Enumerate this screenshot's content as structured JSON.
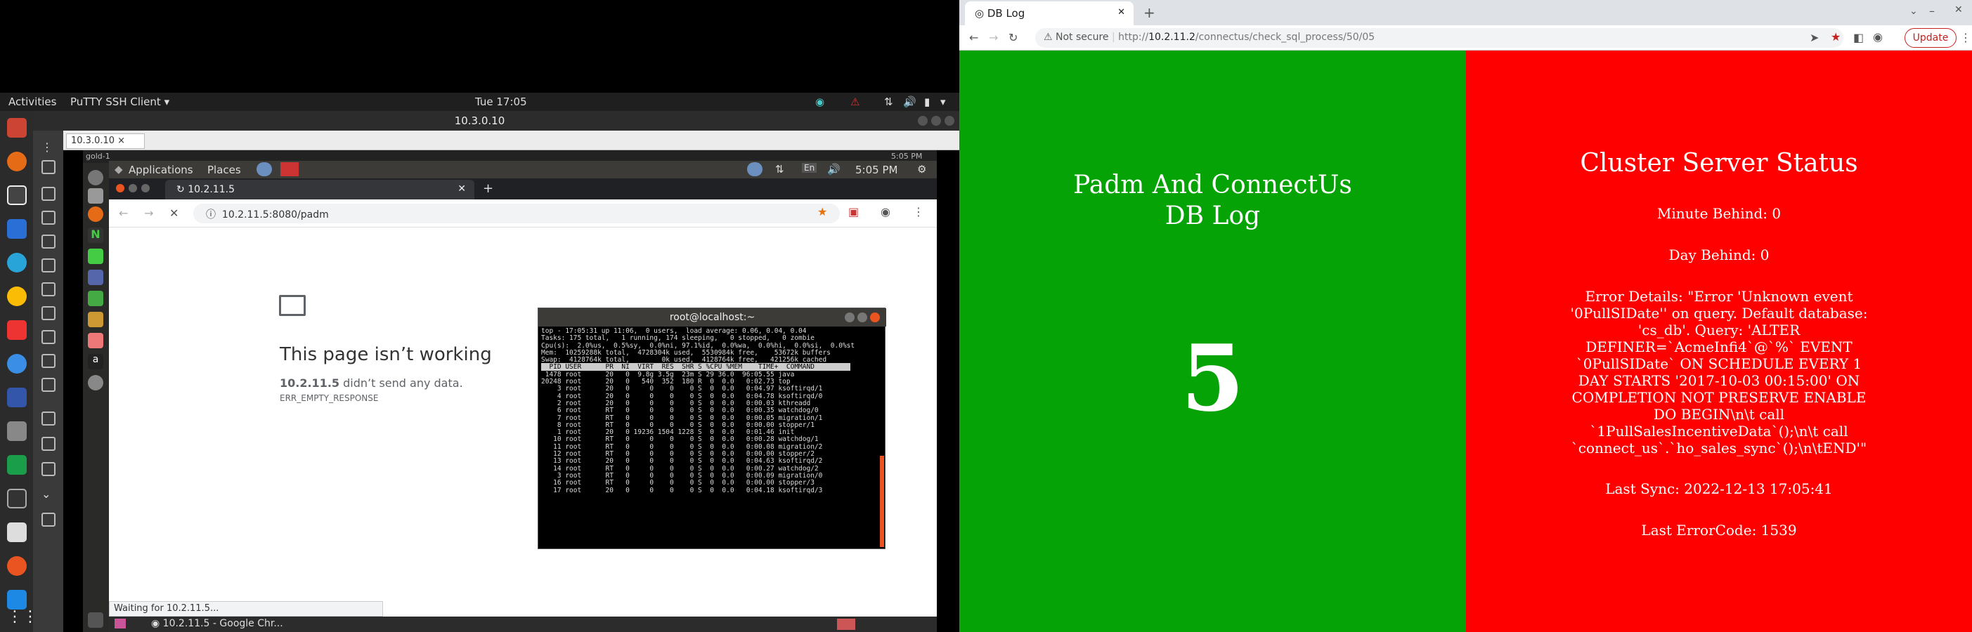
{
  "ubuntu": {
    "activities": "Activities",
    "app": "PuTTY SSH Client ▾",
    "clock": "Tue 17:05",
    "window_title": "10.3.0.10"
  },
  "putty": {
    "tab": "10.3.0.10  ×",
    "host": "gold-1"
  },
  "remote": {
    "topbar_time": "5:05 PM",
    "applications": "Applications",
    "places": "Places",
    "lang": "En",
    "clock": "5:05 PM"
  },
  "inner_chrome": {
    "tab": "10.2.11.5",
    "url": "10.2.11.5:8080/padm",
    "error_title": "This page isn’t working",
    "error_host": "10.2.11.5",
    "error_sub": " didn’t send any data.",
    "error_code": "ERR_EMPTY_RESPONSE",
    "status": "Waiting for 10.2.11.5...",
    "taskbar_item": "10.2.11.5 - Google Chr..."
  },
  "terminal": {
    "title": "root@localhost:~",
    "summary": "top - 17:05:31 up 11:06,  0 users,  load average: 0.06, 0.04, 0.04\nTasks: 175 total,   1 running, 174 sleeping,   0 stopped,   0 zombie\nCpu(s):  2.0%us,  0.5%sy,  0.0%ni, 97.1%id,  0.0%wa,  0.0%hi,  0.0%si,  0.0%st\nMem:  10259288k total,  4728304k used,  5530984k free,    53672k buffers\nSwap:  4128764k total,        0k used,  4128764k free,   421256k cached\n",
    "header": "  PID USER      PR  NI  VIRT  RES  SHR S %CPU %MEM    TIME+  COMMAND         ",
    "rows": " 1478 root      20   0  9.8g 3.5g  23m S 29 36.0  96:05.55 java\n20248 root      20   0   540  352  180 R  0  0.0   0:02.73 top\n    3 root      20   0     0    0    0 S  0  0.0   0:04.97 ksoftirqd/1\n    4 root      20   0     0    0    0 S  0  0.0   0:04.78 ksoftirqd/0\n    2 root      20   0     0    0    0 S  0  0.0   0:00.03 kthreadd\n    6 root      RT   0     0    0    0 S  0  0.0   0:00.35 watchdog/0\n    7 root      RT   0     0    0    0 S  0  0.0   0:00.05 migration/1\n    8 root      RT   0     0    0    0 S  0  0.0   0:00.00 stopper/1\n    1 root      20   0 19236 1504 1228 S  0  0.0   0:01.46 init\n   10 root      RT   0     0    0    0 S  0  0.0   0:00.28 watchdog/1\n   11 root      RT   0     0    0    0 S  0  0.0   0:00.08 migration/2\n   12 root      RT   0     0    0    0 S  0  0.0   0:00.00 stopper/2\n   13 root      20   0     0    0    0 S  0  0.0   0:04.63 ksoftirqd/2\n   14 root      RT   0     0    0    0 S  0  0.0   0:00.27 watchdog/2\n    3 root      RT   0     0    0    0 S  0  0.0   0:00.09 migration/0\n   16 root      RT   0     0    0    0 S  0  0.0   0:00.00 stopper/3\n   17 root      20   0     0    0    0 S  0  0.0   0:04.18 ksoftirqd/3"
  },
  "browser": {
    "tab": "DB Log",
    "not_secure": "Not secure",
    "url_prefix": "http://",
    "url_host": "10.2.11.2",
    "url_path": "/connectus/check_sql_process/50/05",
    "update": "Update"
  },
  "dblog": {
    "title_line1": "Padm And ConnectUs",
    "title_line2": "DB Log",
    "count": "5",
    "status_title": "Cluster Server Status",
    "minute_behind": "Minute Behind: 0",
    "day_behind": "Day Behind: 0",
    "error_details": "Error Details: \"Error 'Unknown event '0PullSIDate'' on query. Default database: 'cs_db'. Query: 'ALTER DEFINER=`AcmeInfi4`@`%` EVENT `0PullSIDate` ON SCHEDULE EVERY 1 DAY STARTS '2017-10-03 00:15:00' ON COMPLETION NOT PRESERVE ENABLE DO BEGIN\\n\\t call `1PullSalesIncentiveData`();\\n\\t call `connect_us`.`ho_sales_sync`();\\n\\tEND'\"",
    "last_sync": "Last Sync: 2022-12-13 17:05:41",
    "last_error": "Last ErrorCode: 1539"
  },
  "colors": {
    "green": "#05a305",
    "red": "#ff0000"
  }
}
